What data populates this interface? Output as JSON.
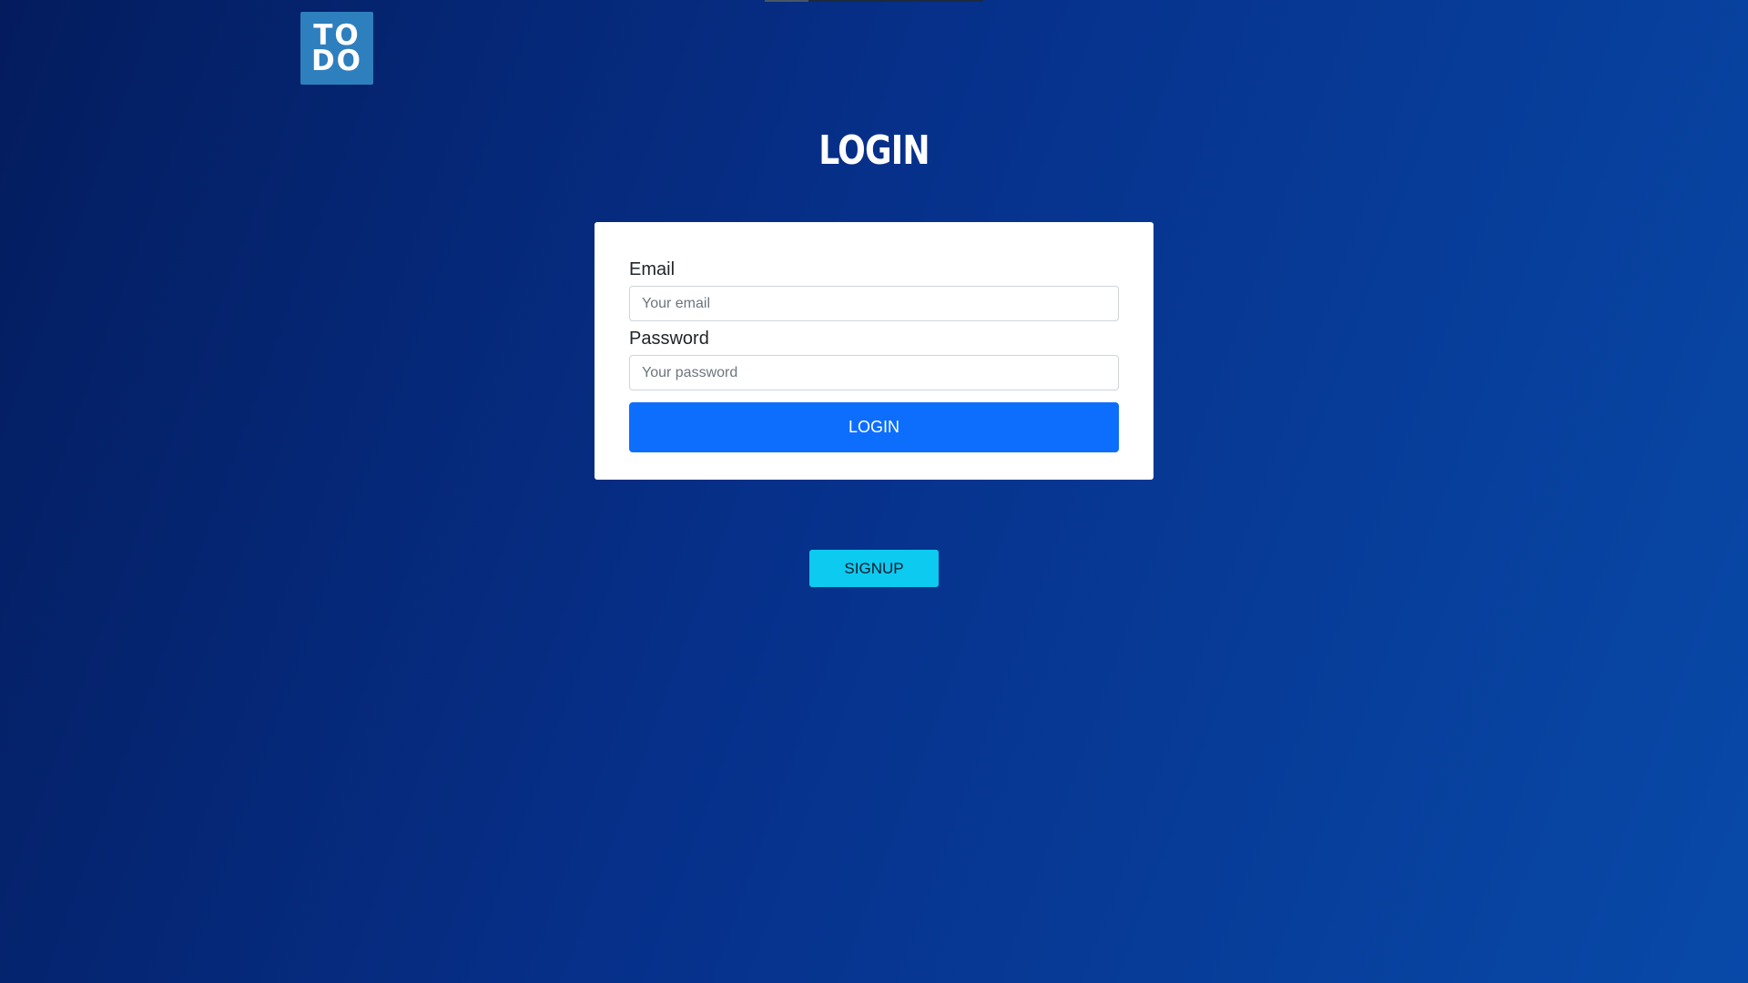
{
  "logo": {
    "line1": "TO",
    "line2": "DO"
  },
  "page": {
    "title": "LOGIN"
  },
  "form": {
    "email_label": "Email",
    "email_placeholder": "Your email",
    "password_label": "Password",
    "password_placeholder": "Your password",
    "submit_label": "LOGIN"
  },
  "signup": {
    "label": "SIGNUP"
  },
  "colors": {
    "background_start": "#041c5e",
    "background_end": "#0849a8",
    "logo_bg": "#2e7fbe",
    "primary_button": "#0d6efd",
    "signup_button": "#0dcaf0"
  }
}
